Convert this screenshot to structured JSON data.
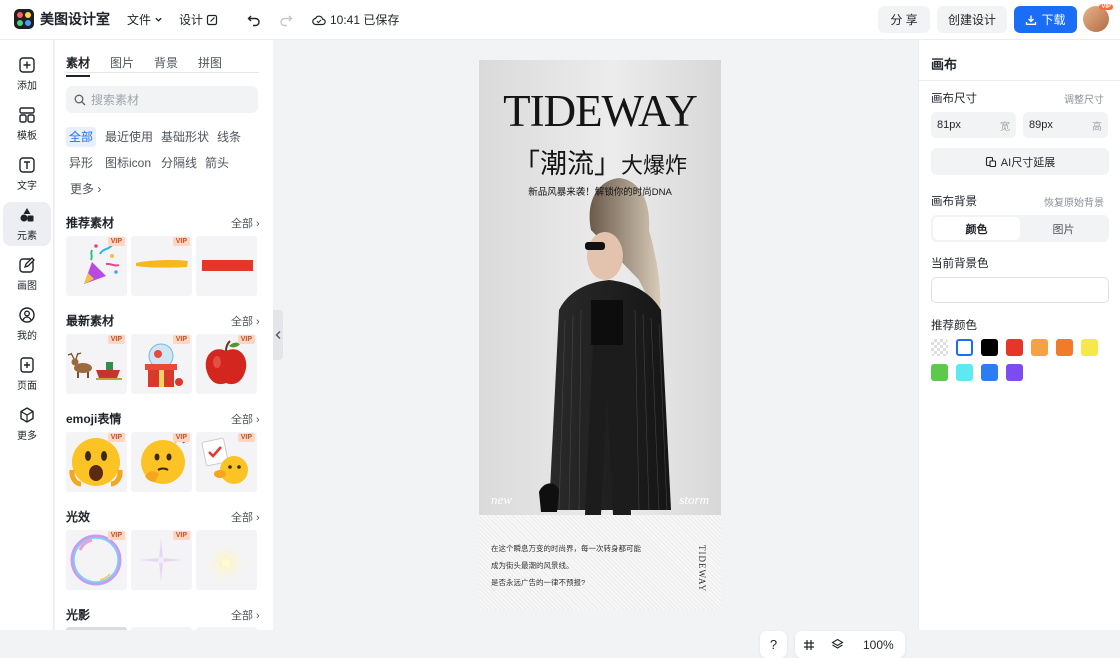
{
  "app": {
    "name": "美图设计室"
  },
  "topbar": {
    "file_menu": "文件",
    "design_menu": "设计",
    "save_status": "10:41 已保存",
    "share_label": "分 享",
    "create_label": "创建设计",
    "download_label": "下载",
    "avatar_badge": "VIP"
  },
  "leftnav": {
    "items": [
      {
        "label": "添加",
        "icon": "plus-square-icon"
      },
      {
        "label": "模板",
        "icon": "template-icon"
      },
      {
        "label": "文字",
        "icon": "text-icon"
      },
      {
        "label": "元素",
        "icon": "shapes-icon"
      },
      {
        "label": "画图",
        "icon": "draw-icon"
      },
      {
        "label": "我的",
        "icon": "user-icon"
      },
      {
        "label": "页面",
        "icon": "page-add-icon"
      },
      {
        "label": "更多",
        "icon": "cube-icon"
      }
    ],
    "active": "元素"
  },
  "panel": {
    "tabs": [
      "素材",
      "图片",
      "背景",
      "拼图"
    ],
    "search_placeholder": "搜索素材",
    "chips": [
      "全部",
      "最近使用",
      "基础形状",
      "线条",
      "异形",
      "图标icon",
      "分隔线",
      "箭头",
      "更多"
    ],
    "vip_badge": "VIP",
    "sections": [
      {
        "title": "推荐素材",
        "all": "全部"
      },
      {
        "title": "最新素材",
        "all": "全部"
      },
      {
        "title": "emoji表情",
        "all": "全部"
      },
      {
        "title": "光效",
        "all": "全部"
      },
      {
        "title": "光影",
        "all": "全部"
      }
    ]
  },
  "poster": {
    "title": "TIDEWAY",
    "subtitle_bracket": "「潮流」",
    "subtitle_rest": "大爆炸",
    "tagline": "新品风暴来袭！解锁你的时尚DNA",
    "word_left": "new",
    "word_right": "storm",
    "body_lines": [
      "在这个瞬息万变的时尚界，每一次转身都可能",
      "成为街头最潮的风景线。",
      "是否永远广告的一律不预报?"
    ],
    "vertical_text": "TIDEWAY"
  },
  "zoom": {
    "help": "?",
    "level": "100%"
  },
  "rightpanel": {
    "title": "画布",
    "size_label": "画布尺寸",
    "adjust_size": "调整尺寸",
    "width_value": "81px",
    "width_unit": "宽",
    "height_value": "89px",
    "height_unit": "高",
    "ai_extend": "AI尺寸延展",
    "bg_label": "画布背景",
    "restore_bg": "恢复原始背景",
    "seg_color": "颜色",
    "seg_image": "图片",
    "current_bg_label": "当前背景色",
    "recommended_label": "推荐颜色",
    "colors": [
      "transparent",
      "#ffffff",
      "#000000",
      "#e8352a",
      "#f5a146",
      "#f07c2a",
      "#f7e84a",
      "#5cc94a",
      "#5ee8f0",
      "#2a7ef0",
      "#7d4cf0"
    ]
  },
  "accent_color": "#1a6ef5"
}
